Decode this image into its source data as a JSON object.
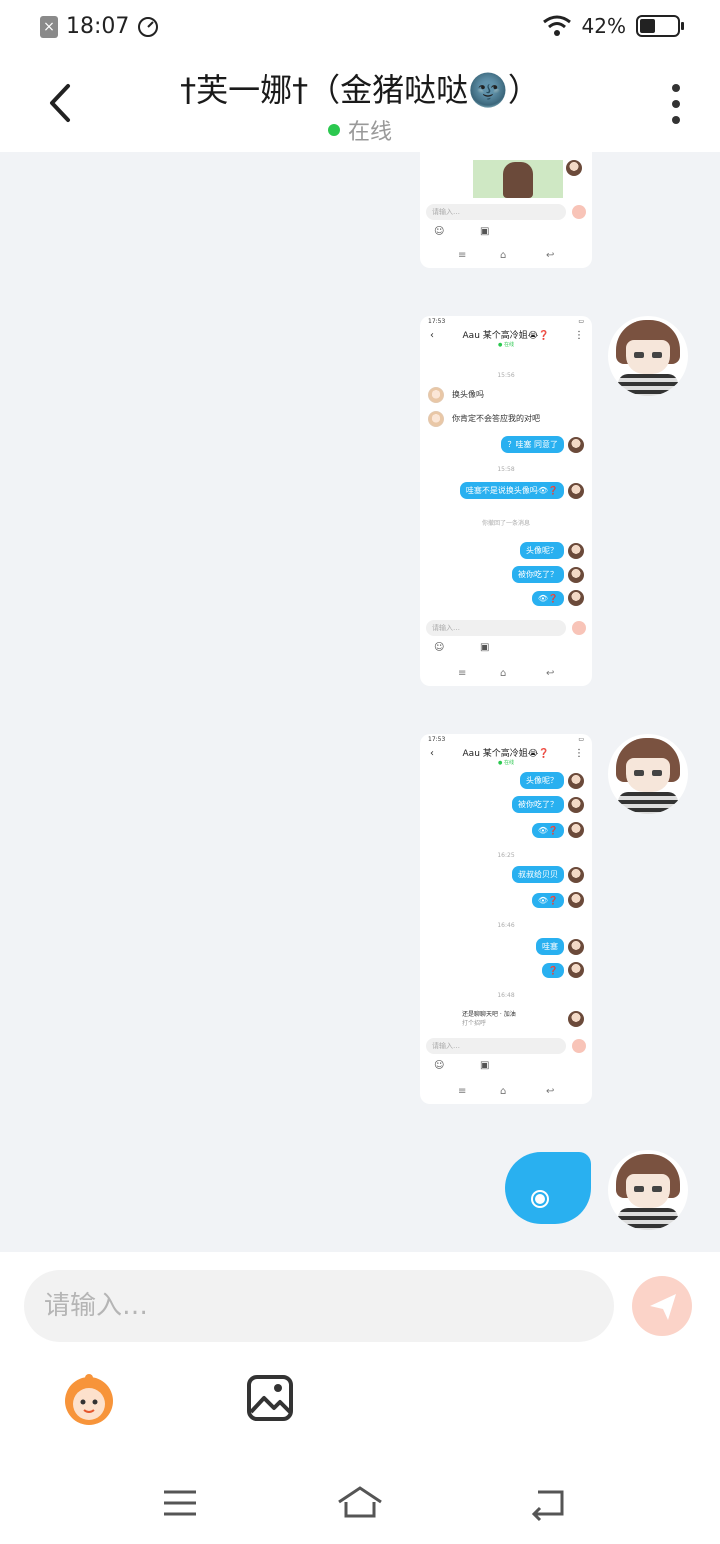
{
  "status_bar": {
    "time": "18:07",
    "battery_pct": "42%",
    "battery_level": 0.42
  },
  "header": {
    "title": "†芙一娜†（金猪哒哒🌚）",
    "status": "在线"
  },
  "screenshot_common": {
    "input_placeholder": "请输入…"
  },
  "screenshot2": {
    "time_small": "17:53",
    "title": "Aau 某个高冷姐😭❓",
    "online": "● 在线",
    "ts1": "15:56",
    "msg_left_1": "换头像吗",
    "msg_left_2": "你肯定不会答应我的对吧",
    "msg_right_1": "？哇塞 同意了",
    "ts2": "15:58",
    "msg_right_2": "哇塞不是说换头像吗👁❓",
    "notice": "你撤回了一条消息",
    "msg_right_3": "头像呢？",
    "msg_right_4": "被你吃了？",
    "msg_right_5": "👁❓"
  },
  "screenshot3": {
    "time_small": "17:53",
    "title": "Aau 某个高冷姐😭❓",
    "online": "● 在线",
    "msg_1": "头像呢？",
    "msg_2": "被你吃了？",
    "msg_3": "👁❓",
    "ts1": "16:25",
    "msg_4": "叔叔给贝贝",
    "msg_5": "👁❓",
    "ts2": "16:46",
    "msg_6": "哇塞",
    "msg_7": "❓",
    "ts3": "16:48",
    "card_text": "还是聊聊天吧 · 加油",
    "card_sub": "打个招呼"
  },
  "input": {
    "placeholder": "请输入…"
  },
  "colors": {
    "bubble_blue": "#29b0f0",
    "chat_bg": "#f1f3f6",
    "online_green": "#2bc84f",
    "send_disabled": "#fbd3c8"
  }
}
